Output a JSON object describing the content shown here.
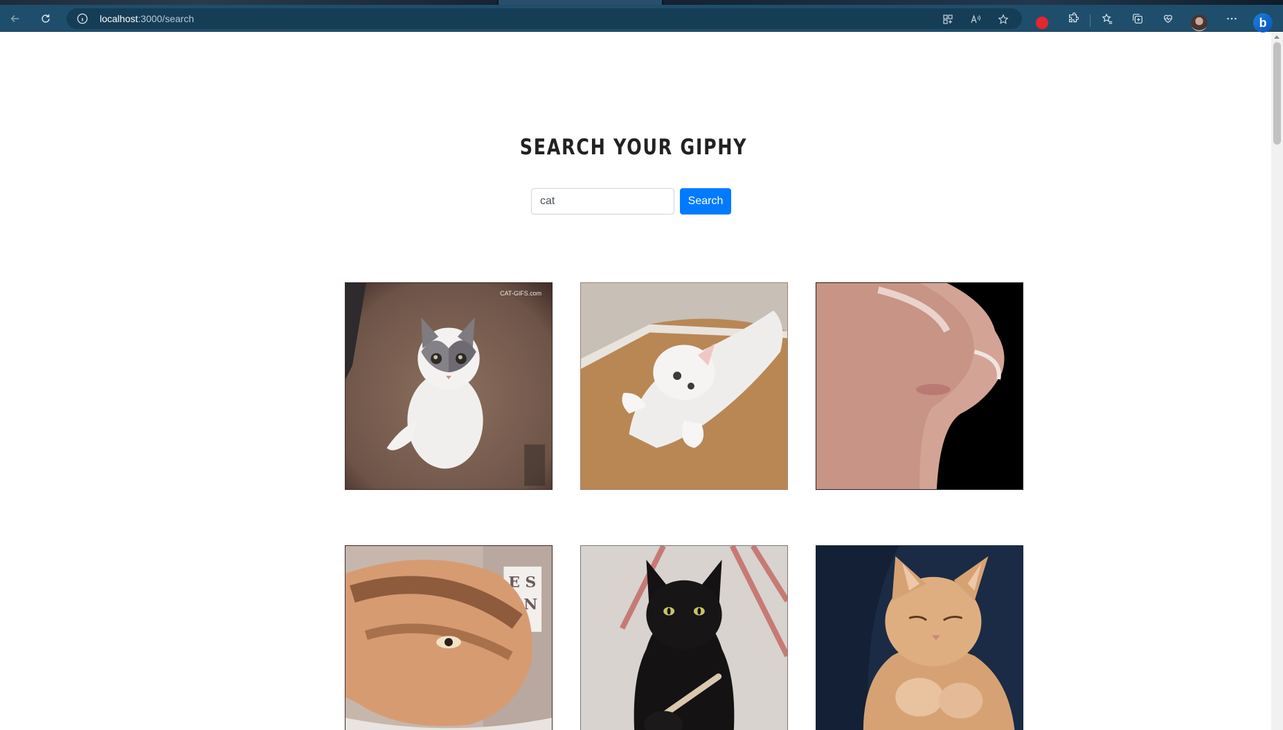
{
  "browser": {
    "url_host": "localhost",
    "url_path": ":3000/search"
  },
  "page": {
    "title": "SEARCH YOUR GIPHY",
    "search": {
      "value": "cat",
      "button_label": "Search"
    },
    "watermark": "CAT-GIFS.com",
    "sign_text": [
      "E S",
      "P N"
    ]
  }
}
